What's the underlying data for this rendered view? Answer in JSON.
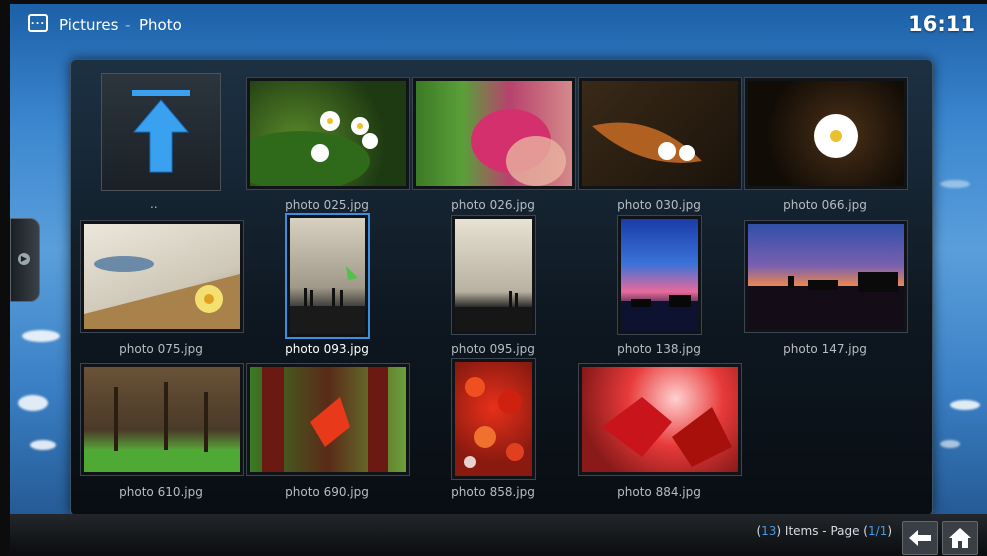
{
  "header": {
    "breadcrumb": [
      "Pictures",
      "Photo"
    ],
    "separator": "-",
    "clock": "16:11"
  },
  "grid": {
    "up_label": "..",
    "items": [
      {
        "label": "photo 025.jpg"
      },
      {
        "label": "photo 026.jpg"
      },
      {
        "label": "photo 030.jpg"
      },
      {
        "label": "photo 066.jpg"
      },
      {
        "label": "photo 075.jpg"
      },
      {
        "label": "photo 093.jpg",
        "selected": true
      },
      {
        "label": "photo 095.jpg"
      },
      {
        "label": "photo 138.jpg"
      },
      {
        "label": "photo 147.jpg"
      },
      {
        "label": "photo 610.jpg"
      },
      {
        "label": "photo 690.jpg"
      },
      {
        "label": "photo 858.jpg"
      },
      {
        "label": "photo 884.jpg"
      }
    ]
  },
  "status": {
    "open1": "(",
    "count": "13",
    "mid": ") Items - Page (",
    "page": "1/1",
    "close": ")"
  },
  "colors": {
    "accent": "#3b8fe0",
    "panel": "#0f1820"
  },
  "icons": [
    "menu-icon",
    "up-arrow-icon",
    "back-arrow-icon",
    "home-icon",
    "side-panel-icon"
  ]
}
